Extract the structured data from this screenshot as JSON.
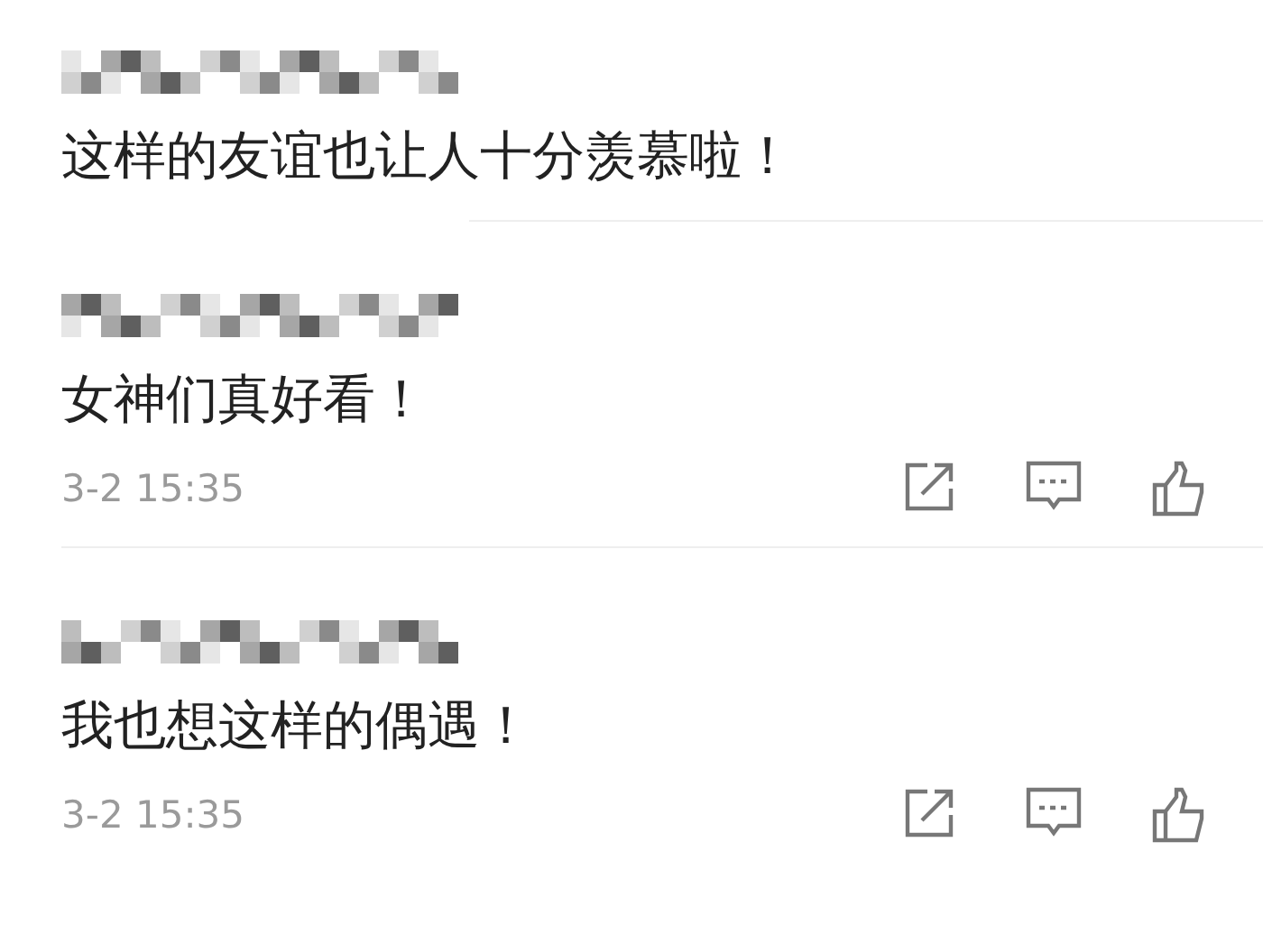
{
  "comments": [
    {
      "text": "这样的友谊也让人十分羡慕啦！"
    },
    {
      "text": "女神们真好看！",
      "time": "3-2 15:35"
    },
    {
      "text": "我也想这样的偶遇！",
      "time": "3-2 15:35"
    }
  ]
}
